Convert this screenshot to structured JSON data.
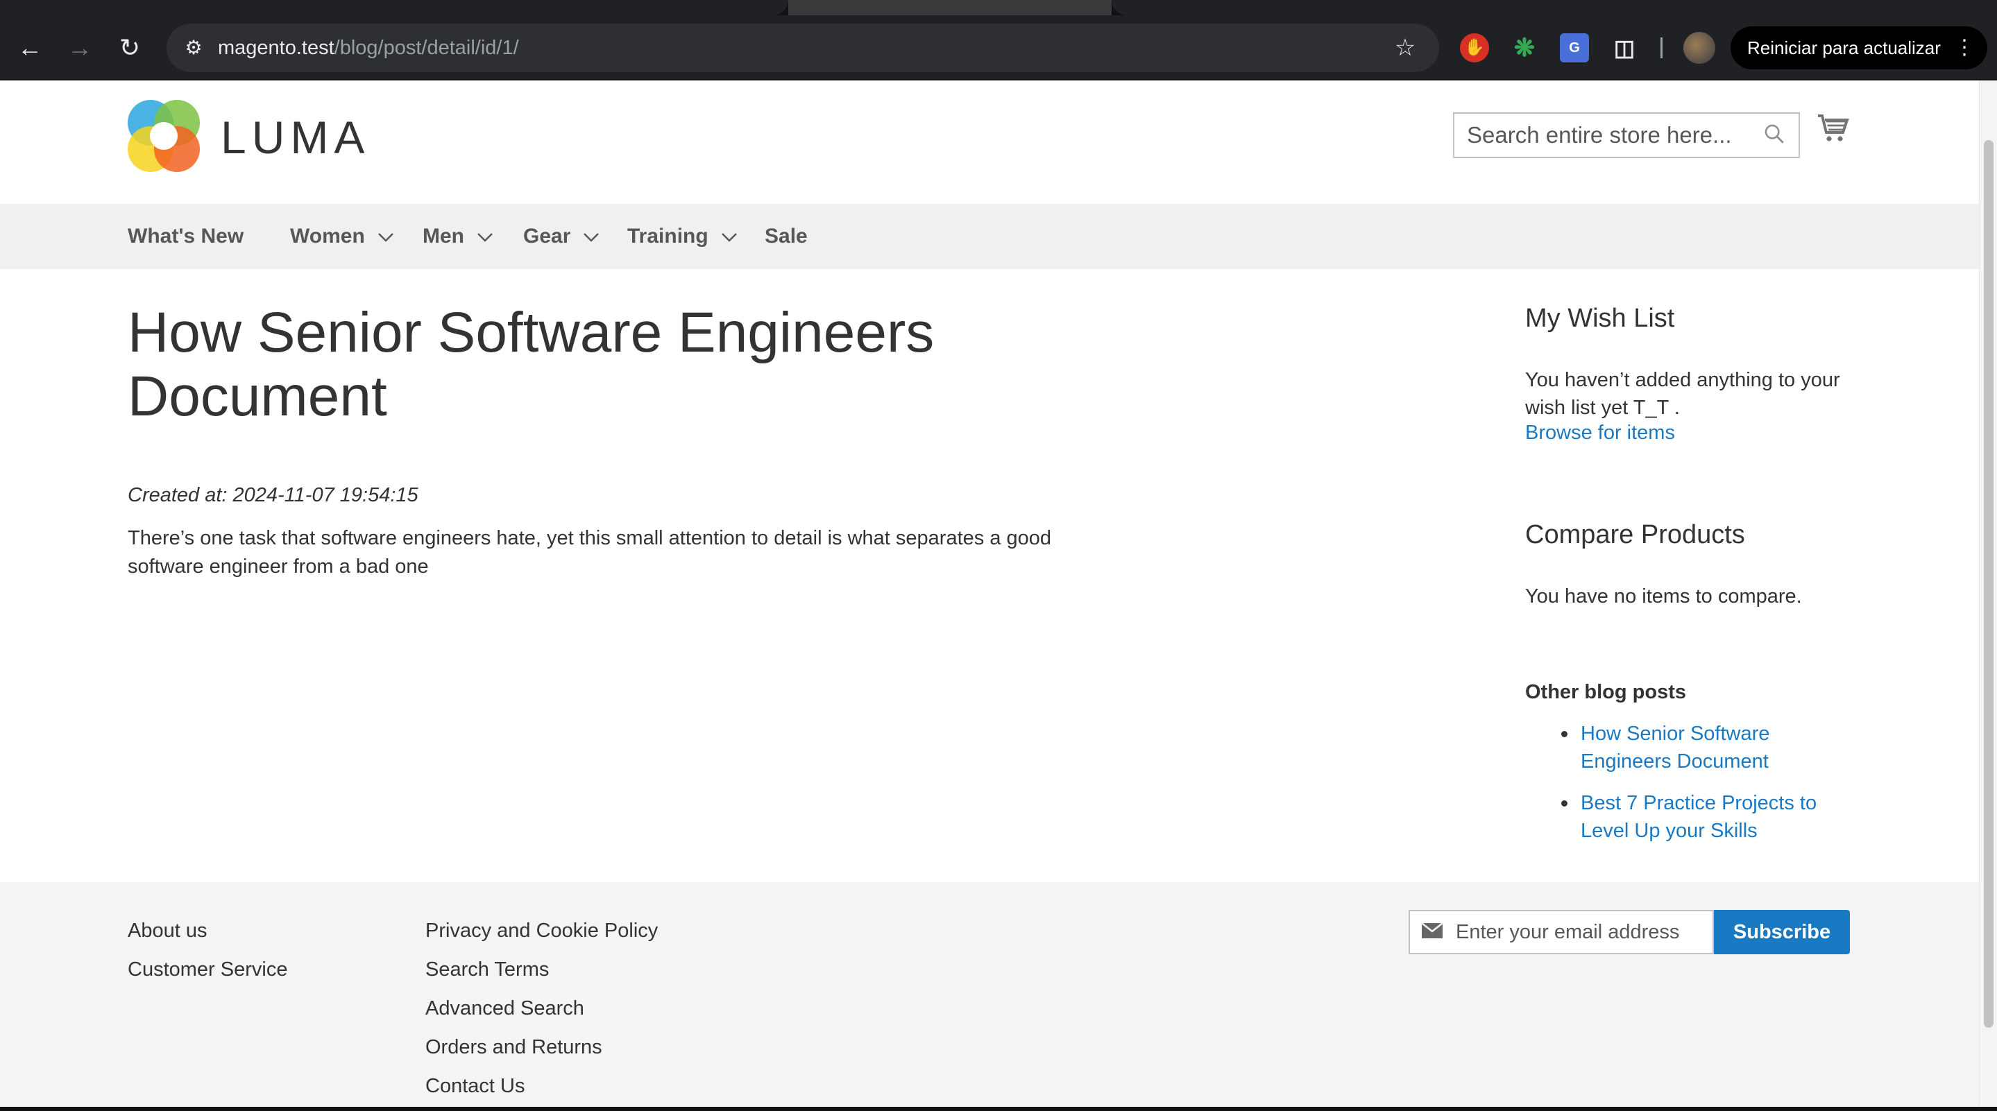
{
  "browser": {
    "url_host": "magento.test",
    "url_path": "/blog/post/detail/id/1/",
    "update_button": "Reiniciar para actualizar"
  },
  "store": {
    "logo_text": "LUMA",
    "search_placeholder": "Search entire store here...",
    "nav": [
      {
        "label": "What's New",
        "has_dropdown": false
      },
      {
        "label": "Women",
        "has_dropdown": true
      },
      {
        "label": "Men",
        "has_dropdown": true
      },
      {
        "label": "Gear",
        "has_dropdown": true
      },
      {
        "label": "Training",
        "has_dropdown": true
      },
      {
        "label": "Sale",
        "has_dropdown": false
      }
    ]
  },
  "post": {
    "title": "How Senior Software Engineers Document",
    "created": "Created at: 2024-11-07 19:54:15",
    "body": "There’s one task that software engineers hate, yet this small attention to detail is what separates a good software engineer from a bad one"
  },
  "sidebar": {
    "wishlist_title": "My Wish List",
    "wishlist_text": "You haven’t added anything to your wish list yet T_T .",
    "wishlist_link": "Browse for items",
    "compare_title": "Compare Products",
    "compare_text": "You have no items to compare.",
    "other_title": "Other blog posts",
    "other_posts": [
      "How Senior Software Engineers Document",
      "Best 7 Practice Projects to Level Up your Skills"
    ]
  },
  "footer": {
    "col1": [
      "About us",
      "Customer Service"
    ],
    "col2": [
      "Privacy and Cookie Policy",
      "Search Terms",
      "Advanced Search",
      "Orders and Returns",
      "Contact Us"
    ],
    "email_placeholder": "Enter your email address",
    "subscribe_label": "Subscribe"
  },
  "colors": {
    "link": "#1979c3",
    "nav_bg": "#f0f0f0",
    "footer_bg": "#f4f4f4"
  }
}
